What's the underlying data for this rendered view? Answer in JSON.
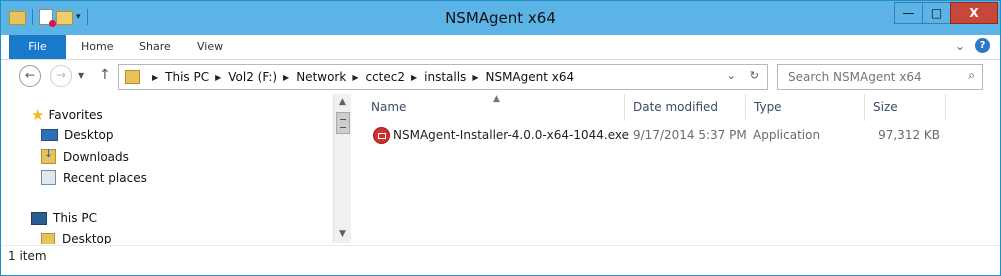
{
  "window": {
    "title": "NSMAgent x64"
  },
  "titlebar": {
    "minimize": "—",
    "maximize": "□",
    "close": "X"
  },
  "ribbon": {
    "tabs": [
      "File",
      "Home",
      "Share",
      "View"
    ]
  },
  "nav": {
    "breadcrumb": [
      "This PC",
      "Vol2 (F:)",
      "Network",
      "cctec2",
      "installs",
      "NSMAgent x64"
    ],
    "search_placeholder": "Search NSMAgent x64"
  },
  "sidebar": {
    "favorites": "Favorites",
    "items": [
      {
        "label": "Desktop",
        "icon": "desktop-icon"
      },
      {
        "label": "Downloads",
        "icon": "downloads-icon"
      },
      {
        "label": "Recent places",
        "icon": "recent-places-icon"
      }
    ],
    "this_pc": "This PC",
    "pc_items": [
      {
        "label": "Desktop",
        "icon": "desktop-folder-icon"
      }
    ]
  },
  "columns": [
    "Name",
    "Date modified",
    "Type",
    "Size"
  ],
  "files": [
    {
      "name": "NSMAgent-Installer-4.0.0-x64-1044.exe",
      "date": "9/17/2014 5:37 PM",
      "type": "Application",
      "size": "97,312 KB",
      "icon": "exe-installer-icon"
    }
  ],
  "status": {
    "text": "1 item"
  },
  "colors": {
    "titlebar": "#5cb3e6",
    "file_tab": "#1979ca",
    "close": "#c7473b"
  }
}
